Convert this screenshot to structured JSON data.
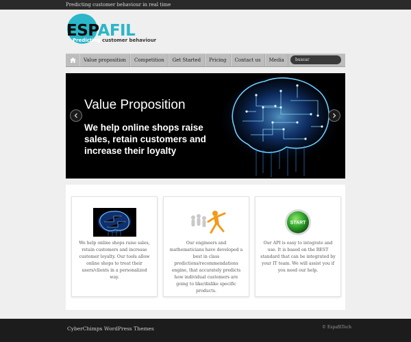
{
  "topbar": {
    "tagline": "Predicting customer behaviour in real time"
  },
  "logo": {
    "part1": "ESP",
    "part2": "AFIL",
    "tagline_part1": "Predicting",
    "tagline_part2": "customer behaviour"
  },
  "nav": {
    "home_icon": "home-icon",
    "items": [
      {
        "label": "Value proposition"
      },
      {
        "label": "Competition"
      },
      {
        "label": "Get Started"
      },
      {
        "label": "Pricing"
      },
      {
        "label": "Contact us"
      },
      {
        "label": "Media"
      }
    ],
    "search": {
      "placeholder": "buscar"
    }
  },
  "slider": {
    "title": "Value Proposition",
    "text": "We help online shops raise sales, retain customers and increase their loyalty",
    "prev_icon": "chevron-left-icon",
    "next_icon": "chevron-right-icon"
  },
  "features": [
    {
      "image": "brain-thumbnail",
      "text": "We help online shops raise sales, retain customers and increase customer loyalty. Our tools allow online shops to treat their users/clients in a personalized way."
    },
    {
      "image": "leader-figure",
      "text": "Our engineers and mathematicians have developed a best in class predictions/recommendations engine, that accurately predicts how individual customers are going to like/dislike specific products."
    },
    {
      "image": "start-button",
      "start_label": "START",
      "text": "Our API is easy to integrate and use. It is based on the REST standard that can be integrated by your IT team. We will assist you if you need our help."
    }
  ],
  "footer": {
    "themes": "CyberChimps WordPress Themes",
    "copyright": "© EspafilTech"
  },
  "colors": {
    "accent": "#2bb6c9",
    "nav": "#bdbdbd",
    "footer": "#1c1c1c",
    "slider_bg": "#000000"
  }
}
